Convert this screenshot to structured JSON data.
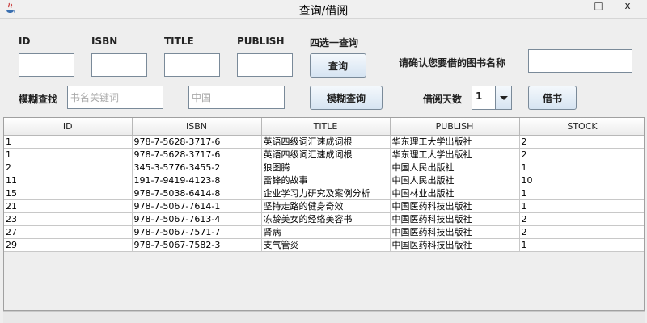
{
  "window": {
    "title": "查询/借阅",
    "minimize_glyph": "—",
    "maximize_glyph": "□",
    "close_glyph": "x",
    "icon": "java-icon"
  },
  "search": {
    "id_label": "ID",
    "isbn_label": "ISBN",
    "title_label": "TITLE",
    "publish_label": "PUBLISH",
    "choose_label": "四选一查询",
    "query_button": "查询",
    "id_value": "",
    "isbn_value": "",
    "title_value": "",
    "publish_value": ""
  },
  "fuzzy": {
    "label": "模糊查找",
    "keyword_placeholder": "书名关键词",
    "publisher_placeholder": "中国",
    "button": "模糊查询"
  },
  "borrow": {
    "confirm_label": "请确认您要借的图书名称",
    "book_name_value": "",
    "days_label": "借阅天数",
    "days_value": "1",
    "button": "借书"
  },
  "table": {
    "columns": [
      "ID",
      "ISBN",
      "TITLE",
      "PUBLISH",
      "STOCK"
    ],
    "rows": [
      [
        "1",
        "978-7-5628-3717-6",
        "英语四级词汇速成词根",
        "华东理工大学出版社",
        "2"
      ],
      [
        "1",
        "978-7-5628-3717-6",
        "英语四级词汇速成词根",
        "华东理工大学出版社",
        "2"
      ],
      [
        "2",
        "345-3-5776-3455-2",
        "狼图腾",
        "中国人民出版社",
        "1"
      ],
      [
        "11",
        "191-7-9419-4123-8",
        "雷锋的故事",
        "中国人民出版社",
        "10"
      ],
      [
        "15",
        "978-7-5038-6414-8",
        "企业学习力研究及案例分析",
        "中国林业出版社",
        "1"
      ],
      [
        "21",
        "978-7-5067-7614-1",
        "坚持走路的健身奇效",
        "中国医药科技出版社",
        "1"
      ],
      [
        "23",
        "978-7-5067-7613-4",
        "冻龄美女的经络美容书",
        "中国医药科技出版社",
        "2"
      ],
      [
        "27",
        "978-7-5067-7571-7",
        "肾病",
        "中国医药科技出版社",
        "2"
      ],
      [
        "29",
        "978-7-5067-7582-3",
        "支气管炎",
        "中国医药科技出版社",
        "1"
      ]
    ]
  }
}
